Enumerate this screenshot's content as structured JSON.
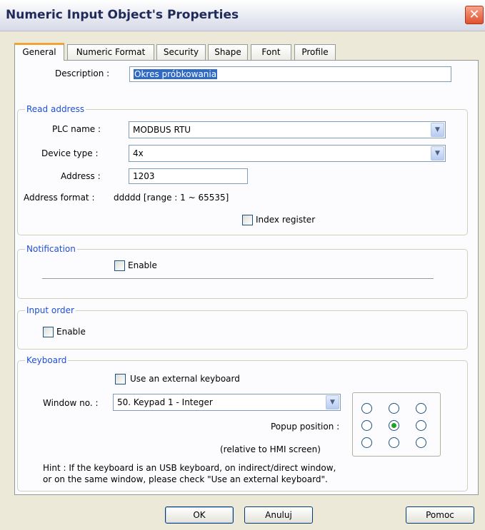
{
  "window": {
    "title": "Numeric Input Object's Properties",
    "close_glyph": "✕"
  },
  "tabs": [
    {
      "label": "General",
      "active": true
    },
    {
      "label": "Numeric Format",
      "active": false
    },
    {
      "label": "Security",
      "active": false
    },
    {
      "label": "Shape",
      "active": false
    },
    {
      "label": "Font",
      "active": false
    },
    {
      "label": "Profile",
      "active": false
    }
  ],
  "general": {
    "description_label": "Description :",
    "description_value": "Okres próbkowania"
  },
  "read_address": {
    "legend": "Read address",
    "plc_name_label": "PLC name :",
    "plc_name_value": "MODBUS RTU",
    "device_type_label": "Device type :",
    "device_type_value": "4x",
    "address_label": "Address :",
    "address_value": "1203",
    "address_format_label": "Address format :",
    "address_format_value": "ddddd [range : 1 ~ 65535]",
    "index_register_label": "Index register",
    "index_register_checked": false
  },
  "notification": {
    "legend": "Notification",
    "enable_label": "Enable",
    "enable_checked": false
  },
  "input_order": {
    "legend": "Input order",
    "enable_label": "Enable",
    "enable_checked": false
  },
  "keyboard": {
    "legend": "Keyboard",
    "external_label": "Use an external keyboard",
    "external_checked": false,
    "window_no_label": "Window no. :",
    "window_no_value": "50. Keypad 1 - Integer",
    "popup_position_label": "Popup position :",
    "popup_relative_label": "(relative to HMI screen)",
    "popup_selected": "center",
    "hint_line1": "Hint : If the keyboard is an USB keyboard, on indirect/direct window,",
    "hint_line2": "or on the same window, please check \"Use an external keyboard\"."
  },
  "buttons": {
    "ok": "OK",
    "cancel": "Anuluj",
    "help": "Pomoc"
  },
  "icons": {
    "dropdown": "chevron-down-icon",
    "close": "close-icon"
  },
  "colors": {
    "legend_blue": "#1f4fd6",
    "tab_highlight": "#f0a434",
    "selection": "#316ac5",
    "radio_dot": "#21a121"
  }
}
